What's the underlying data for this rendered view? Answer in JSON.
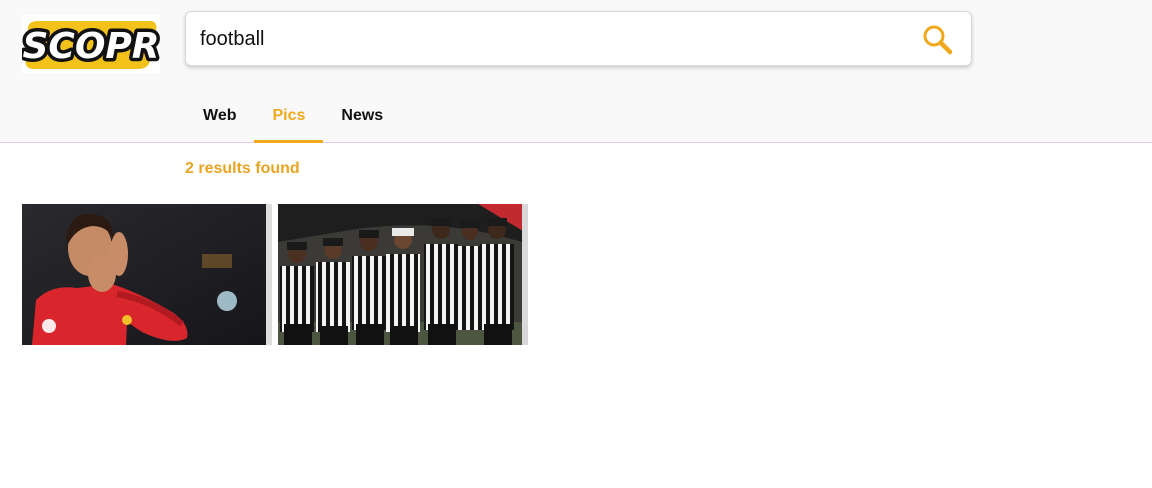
{
  "brand": {
    "logo_text": "SCOPR",
    "accent_color": "#f0a91a"
  },
  "search": {
    "query": "football",
    "button_icon": "magnifier-icon"
  },
  "tabs": [
    {
      "label": "Web",
      "active": false
    },
    {
      "label": "Pics",
      "active": true
    },
    {
      "label": "News",
      "active": false
    }
  ],
  "results": {
    "count_text": "2 results found",
    "images": [
      {
        "subject": "soccer player in red jersey covering mouth with hands"
      },
      {
        "subject": "line of football referees in striped shirts and caps"
      }
    ]
  }
}
